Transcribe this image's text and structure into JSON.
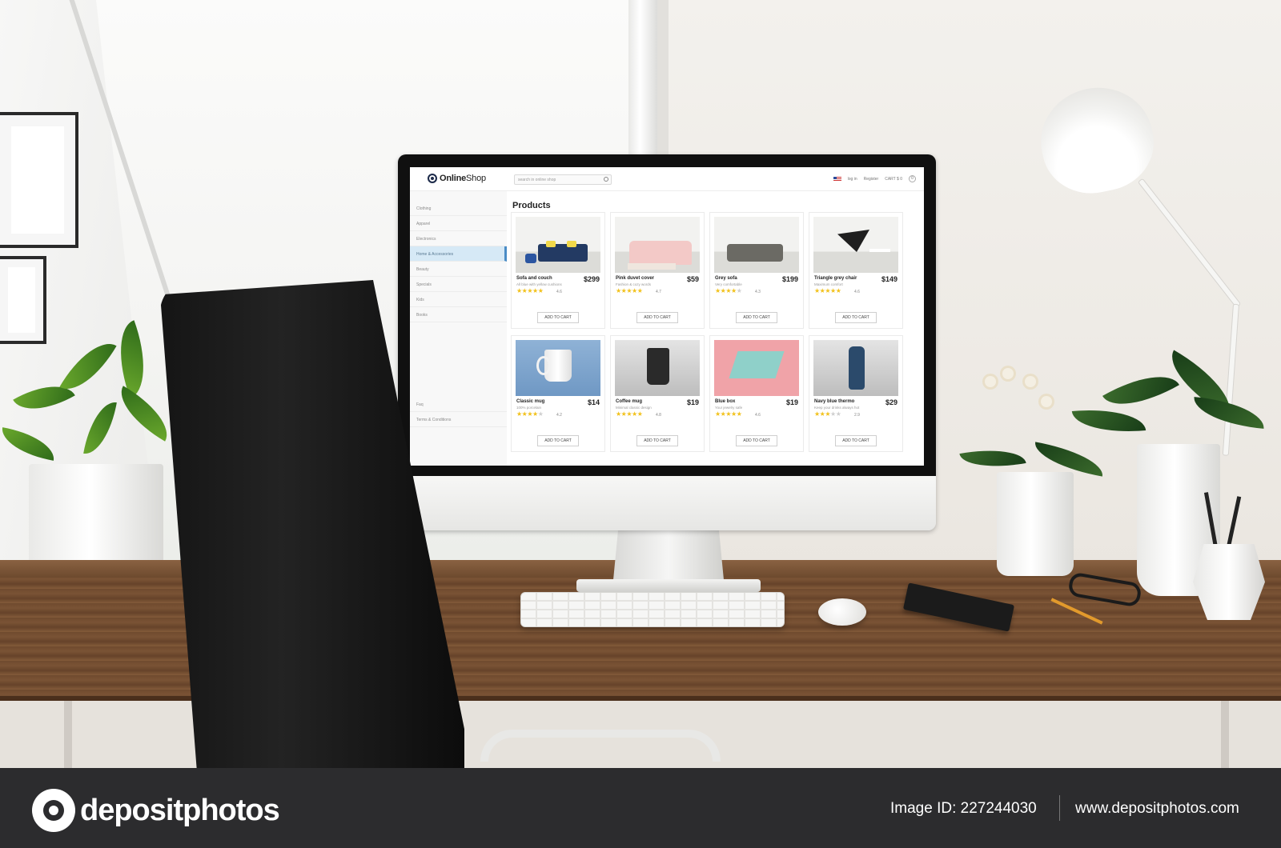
{
  "shop": {
    "logo_bold": "Online",
    "logo_light": "Shop",
    "search_placeholder": "search in online shop",
    "login": "log in",
    "register": "Register",
    "cart": "CART $ 0",
    "cart_count": "0",
    "page_title": "Products"
  },
  "sidebar": {
    "items": [
      {
        "label": "Clothing"
      },
      {
        "label": "Apparel"
      },
      {
        "label": "Electronics"
      },
      {
        "label": "Home & Accessories"
      },
      {
        "label": "Beauty"
      },
      {
        "label": "Specials"
      },
      {
        "label": "Kids"
      },
      {
        "label": "Books"
      }
    ],
    "footer": [
      {
        "label": "Faq"
      },
      {
        "label": "Terms & Conditions"
      }
    ],
    "active_index": 3
  },
  "products": [
    {
      "name": "Sofa and couch",
      "price": "$299",
      "desc": "All blue with yellow cushions",
      "rating": 4.6,
      "rating_text": "4.6",
      "button": "ADD TO CART",
      "image_icon": "sofa-icon"
    },
    {
      "name": "Pink duvet cover",
      "price": "$59",
      "desc": "Fashion & cozy words",
      "rating": 4.7,
      "rating_text": "4.7",
      "button": "ADD TO CART",
      "image_icon": "bed-icon"
    },
    {
      "name": "Grey sofa",
      "price": "$199",
      "desc": "Very comfortable",
      "rating": 4.3,
      "rating_text": "4.3",
      "button": "ADD TO CART",
      "image_icon": "sofa-icon"
    },
    {
      "name": "Triangle grey chair",
      "price": "$149",
      "desc": "Maximum comfort",
      "rating": 4.6,
      "rating_text": "4.6",
      "button": "ADD TO CART",
      "image_icon": "chair-icon"
    },
    {
      "name": "Classic mug",
      "price": "$14",
      "desc": "100% porcelain",
      "rating": 4.2,
      "rating_text": "4.2",
      "button": "ADD TO CART",
      "image_icon": "mug-icon"
    },
    {
      "name": "Coffee mug",
      "price": "$19",
      "desc": "Minimal classic design",
      "rating": 4.8,
      "rating_text": "4.8",
      "button": "ADD TO CART",
      "image_icon": "cup-icon"
    },
    {
      "name": "Blue box",
      "price": "$19",
      "desc": "Your jewelry safe",
      "rating": 4.6,
      "rating_text": "4.6",
      "button": "ADD TO CART",
      "image_icon": "box-icon"
    },
    {
      "name": "Navy blue thermo",
      "price": "$29",
      "desc": "Keep your drinks always hot",
      "rating": 2.9,
      "rating_text": "2.9",
      "button": "ADD TO CART",
      "image_icon": "thermo-icon"
    }
  ],
  "colors": {
    "accent": "#4a8cc6",
    "star": "#f2c11a",
    "watermark_bg": "#2c2c2e"
  },
  "watermark": {
    "brand": "depositphotos",
    "image_id": "Image ID: 227244030",
    "url": "www.depositphotos.com"
  }
}
